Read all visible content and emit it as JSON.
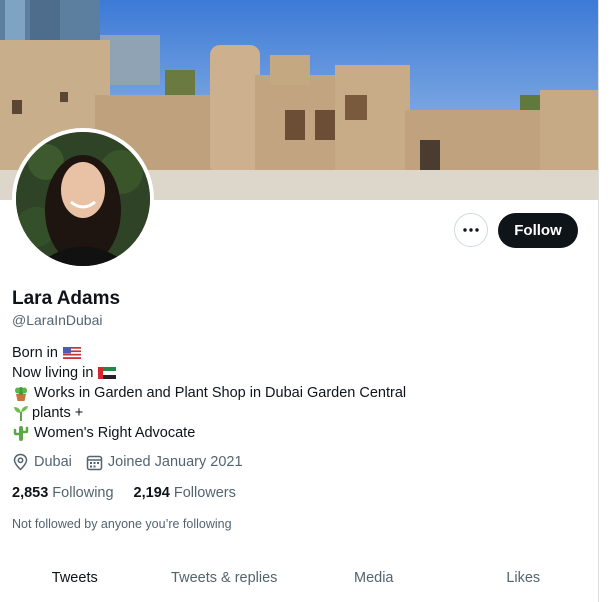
{
  "profile": {
    "name": "Lara Adams",
    "handle": "@LaraInDubai",
    "bio": {
      "born": "Born in",
      "living": "Now living in",
      "work": "Works in Garden and Plant Shop in Dubai Garden Central",
      "plants": "plants +",
      "advocate": "Women's Right Advocate"
    },
    "location": "Dubai",
    "joined": "Joined January 2021",
    "following_count": "2,853",
    "following_label": "Following",
    "followers_count": "2,194",
    "followers_label": "Followers",
    "not_followed": "Not followed by anyone you’re following"
  },
  "actions": {
    "follow_label": "Follow"
  },
  "tabs": [
    {
      "label": "Tweets",
      "active": true
    },
    {
      "label": "Tweets & replies",
      "active": false
    },
    {
      "label": "Media",
      "active": false
    },
    {
      "label": "Likes",
      "active": false
    }
  ],
  "icons": {
    "more": "more-horizontal-icon",
    "location": "location-pin-icon",
    "calendar": "calendar-icon",
    "flag_born": "us-flag-icon",
    "flag_living": "uae-flag-icon",
    "plant_pot": "potted-plant-icon",
    "seedling": "seedling-icon",
    "cactus": "cactus-icon"
  },
  "colors": {
    "text_primary": "#0f1419",
    "text_secondary": "#536471",
    "follow_bg": "#0f1419"
  }
}
